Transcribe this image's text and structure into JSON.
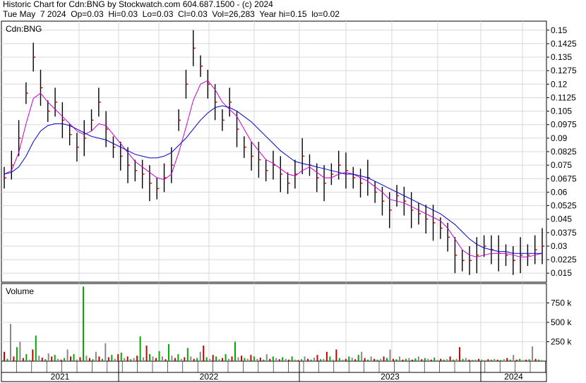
{
  "header": {
    "title": "Historic Chart for Cdn:BNG by Stockwatch.com 604.687.1500 - (c) 2024",
    "stats": "Tue May  7 2024  Op=0.03  Hi=0.03  Lo=0.03  Cl=0.03  Vol=26,283  Year hi=0.15  lo=0.02"
  },
  "chart_data": [
    {
      "type": "line",
      "panel": "price",
      "title": "Cdn:BNG",
      "ylim": [
        0.01,
        0.155
      ],
      "y_ticks": [
        "0.15",
        "0.1425",
        "0.135",
        "0.1275",
        "0.12",
        "0.1125",
        "0.105",
        "0.0975",
        "0.09",
        "0.0825",
        "0.075",
        "0.0675",
        "0.06",
        "0.0525",
        "0.045",
        "0.0375",
        "0.03",
        "0.0225",
        "0.015"
      ],
      "grid": true,
      "series": [
        {
          "name": "",
          "values": [
            0.068,
            0.075,
            0.09,
            0.115,
            0.135,
            0.118,
            0.105,
            0.11,
            0.1,
            0.092,
            0.085,
            0.09,
            0.1,
            0.11,
            0.095,
            0.085,
            0.08,
            0.075,
            0.072,
            0.07,
            0.065,
            0.062,
            0.068,
            0.075,
            0.1,
            0.12,
            0.14,
            0.13,
            0.12,
            0.11,
            0.1,
            0.11,
            0.095,
            0.085,
            0.08,
            0.078,
            0.072,
            0.075,
            0.07,
            0.065,
            0.07,
            0.08,
            0.075,
            0.068,
            0.065,
            0.07,
            0.075,
            0.072,
            0.068,
            0.065,
            0.068,
            0.06,
            0.055,
            0.05,
            0.058,
            0.055,
            0.05,
            0.048,
            0.045,
            0.043,
            0.04,
            0.035,
            0.025,
            0.022,
            0.022,
            0.025,
            0.03,
            0.028,
            0.026,
            0.025,
            0.022,
            0.025,
            0.025,
            0.028,
            0.03
          ],
          "color": "#000000"
        },
        {
          "name": "",
          "values": [
            0.07,
            0.072,
            0.082,
            0.098,
            0.112,
            0.115,
            0.11,
            0.106,
            0.102,
            0.098,
            0.094,
            0.092,
            0.094,
            0.098,
            0.097,
            0.092,
            0.087,
            0.082,
            0.077,
            0.074,
            0.071,
            0.068,
            0.067,
            0.07,
            0.082,
            0.096,
            0.111,
            0.12,
            0.122,
            0.117,
            0.11,
            0.106,
            0.102,
            0.095,
            0.088,
            0.083,
            0.078,
            0.076,
            0.073,
            0.07,
            0.069,
            0.072,
            0.074,
            0.071,
            0.068,
            0.068,
            0.07,
            0.071,
            0.07,
            0.068,
            0.066,
            0.063,
            0.06,
            0.056,
            0.055,
            0.054,
            0.052,
            0.05,
            0.048,
            0.046,
            0.044,
            0.04,
            0.034,
            0.028,
            0.025,
            0.024,
            0.025,
            0.026,
            0.026,
            0.026,
            0.025,
            0.024,
            0.024,
            0.025,
            0.026
          ],
          "color": "#cc00cc"
        },
        {
          "name": "",
          "values": [
            0.07,
            0.071,
            0.074,
            0.08,
            0.088,
            0.094,
            0.097,
            0.098,
            0.098,
            0.097,
            0.095,
            0.093,
            0.091,
            0.09,
            0.089,
            0.087,
            0.085,
            0.083,
            0.081,
            0.08,
            0.079,
            0.079,
            0.08,
            0.082,
            0.086,
            0.09,
            0.095,
            0.1,
            0.104,
            0.107,
            0.108,
            0.107,
            0.105,
            0.102,
            0.099,
            0.095,
            0.091,
            0.087,
            0.083,
            0.08,
            0.077,
            0.076,
            0.075,
            0.074,
            0.073,
            0.072,
            0.071,
            0.07,
            0.07,
            0.069,
            0.068,
            0.066,
            0.064,
            0.062,
            0.06,
            0.058,
            0.056,
            0.054,
            0.052,
            0.05,
            0.048,
            0.045,
            0.042,
            0.038,
            0.034,
            0.031,
            0.029,
            0.028,
            0.027,
            0.027,
            0.026,
            0.026,
            0.026,
            0.026,
            0.026
          ],
          "color": "#0000cc"
        }
      ]
    },
    {
      "type": "bar",
      "panel": "volume",
      "title": "Volume",
      "ylim": [
        0,
        1000000
      ],
      "y_ticks": [
        "750 k",
        "500 k",
        "250 k"
      ],
      "values": [
        120000,
        30000,
        480000,
        60000,
        180000,
        250000,
        40000,
        90000,
        20000,
        150000,
        330000,
        70000,
        45000,
        25000,
        100000,
        60000,
        80000,
        30000,
        20000,
        40000,
        150000,
        60000,
        90000,
        20000,
        50000,
        960000,
        70000,
        40000,
        25000,
        120000,
        60000,
        30000,
        230000,
        50000,
        80000,
        30000,
        90000,
        110000,
        40000,
        60000,
        25000,
        40000,
        70000,
        320000,
        50000,
        200000,
        90000,
        60000,
        40000,
        130000,
        60000,
        25000,
        220000,
        70000,
        40000,
        90000,
        30000,
        50000,
        170000,
        60000,
        30000,
        40000,
        120000,
        200000,
        50000,
        30000,
        80000,
        60000,
        25000,
        40000,
        90000,
        30000,
        60000,
        250000,
        50000,
        70000,
        40000,
        30000,
        80000,
        60000,
        30000,
        45000,
        20000,
        90000,
        30000,
        60000,
        40000,
        25000,
        50000,
        30000,
        20000,
        60000,
        20000,
        15000,
        25000,
        60000,
        30000,
        20000,
        45000,
        80000,
        25000,
        30000,
        120000,
        60000,
        20000,
        150000,
        40000,
        20000,
        30000,
        60000,
        45000,
        25000,
        80000,
        120000,
        40000,
        20000,
        60000,
        30000,
        20000,
        30000,
        60000,
        40000,
        150000,
        30000,
        25000,
        60000,
        20000,
        30000,
        40000,
        20000,
        35000,
        60000,
        25000,
        40000,
        30000,
        20000,
        45000,
        15000,
        30000,
        20000,
        25000,
        60000,
        20000,
        30000,
        180000,
        30000,
        40000,
        20000,
        15000,
        20000,
        30000,
        20000,
        15000,
        25000,
        20000,
        30000,
        20000,
        15000,
        25000,
        40000,
        20000,
        80000,
        20000,
        30000,
        15000,
        20000,
        25000,
        190000,
        30000,
        20000,
        15000
      ],
      "colors": [
        "#cc0000",
        "#00aa00",
        "#888888"
      ]
    }
  ],
  "x_axis": {
    "labels": [
      "2021",
      "2022",
      "2023",
      "2024"
    ]
  }
}
